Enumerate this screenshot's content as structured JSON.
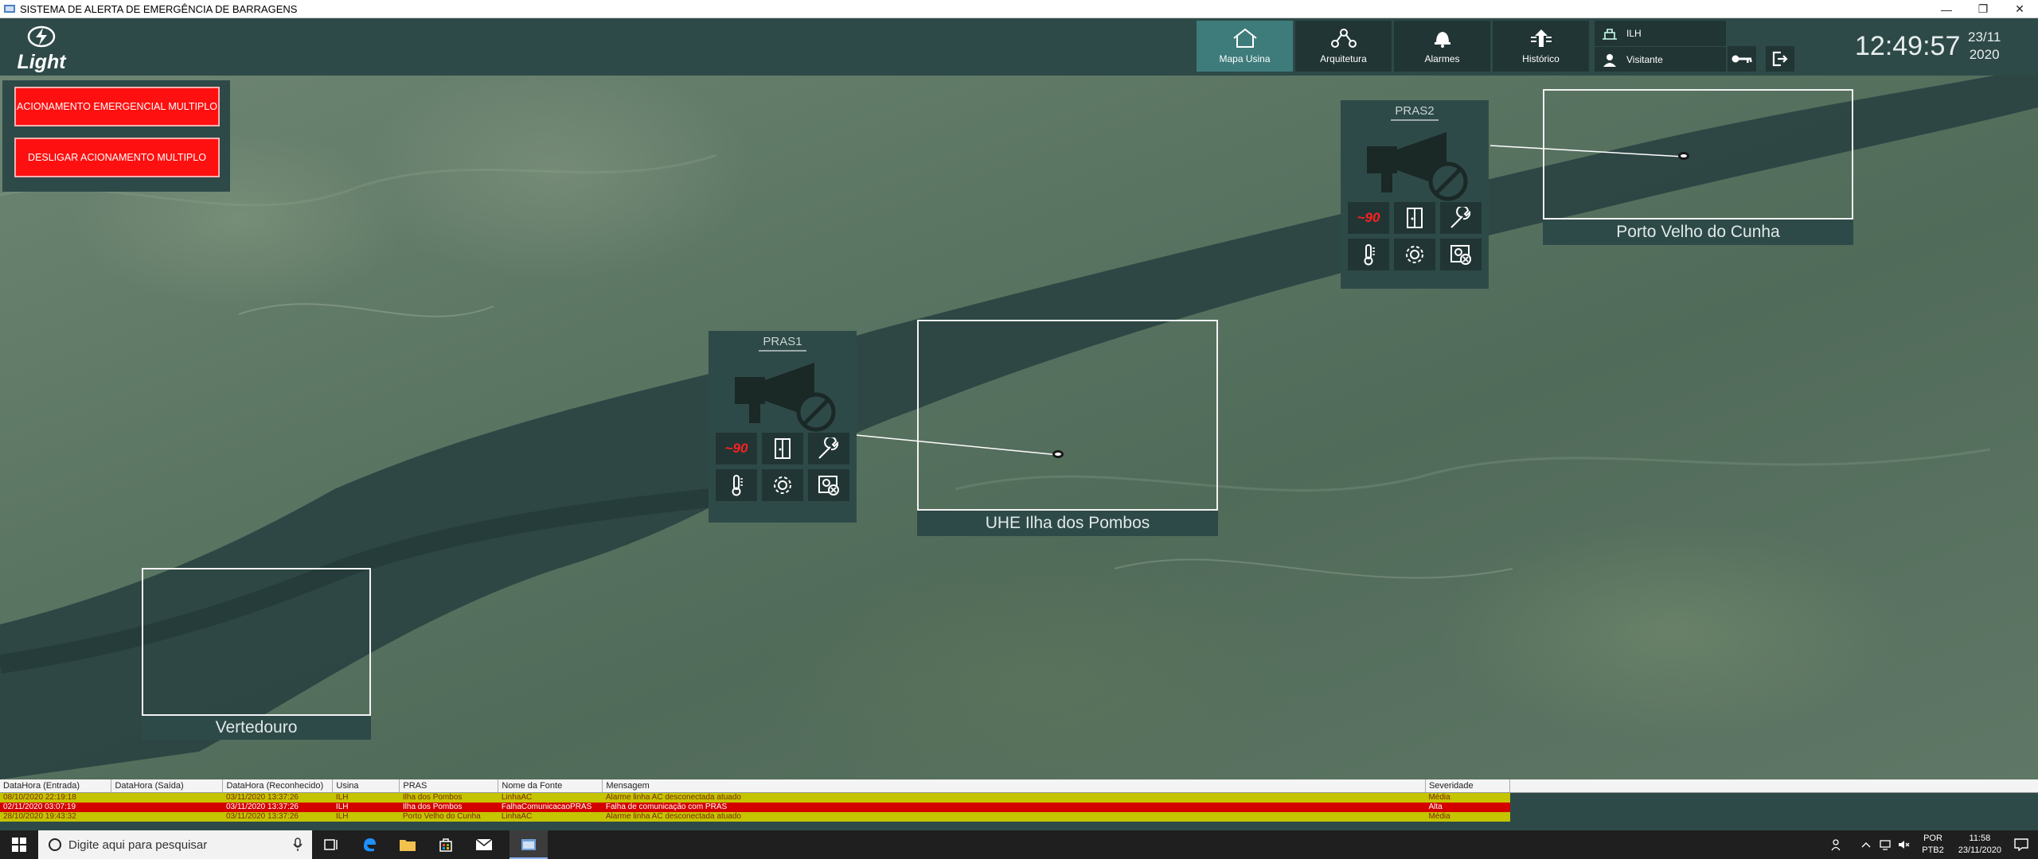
{
  "window": {
    "title": "SISTEMA DE ALERTA DE EMERGÊNCIA DE BARRAGENS",
    "minimize": "—",
    "restore": "❐",
    "close": "✕"
  },
  "header": {
    "logo_text": "Light",
    "nav": [
      {
        "label": "Mapa Usina",
        "icon": "home-icon",
        "active": true
      },
      {
        "label": "Arquitetura",
        "icon": "network-icon",
        "active": false
      },
      {
        "label": "Alarmes",
        "icon": "bell-icon",
        "active": false
      },
      {
        "label": "Histórico",
        "icon": "history-icon",
        "active": false
      }
    ],
    "user": {
      "plant": "ILH",
      "name": "Visitante"
    },
    "clock": "12:49:57",
    "date_day": "23/11",
    "date_year": "2020"
  },
  "controls": {
    "emergency_multi": "ACIONAMENTO EMERGENCIAL MULTIPLO",
    "disable_multi": "DESLIGAR ACIONAMENTO MULTIPLO"
  },
  "map": {
    "pras": [
      {
        "title": "PRAS1",
        "fault_text": "~90"
      },
      {
        "title": "PRAS2",
        "fault_text": "~90"
      }
    ],
    "sites": [
      {
        "label": "UHE Ilha dos Pombos"
      },
      {
        "label": "Porto Velho do Cunha"
      },
      {
        "label": "Vertedouro"
      }
    ]
  },
  "alarms": {
    "columns": [
      "DataHora (Entrada)",
      "DataHora (Saída)",
      "DataHora (Reconhecido)",
      "Usina",
      "PRAS",
      "Nome da Fonte",
      "Mensagem",
      "Severidade"
    ],
    "rows": [
      {
        "entrada": "08/10/2020 22:19:18",
        "saida": "",
        "reconhecido": "03/11/2020 13:37:26",
        "usina": "ILH",
        "pras": "Ilha dos Pombos",
        "fonte": "LinhaAC",
        "mensagem": "Alarme linha AC desconectada atuado",
        "severidade": "Média"
      },
      {
        "entrada": "02/11/2020 03:07:19",
        "saida": "",
        "reconhecido": "03/11/2020 13:37:26",
        "usina": "ILH",
        "pras": "Ilha dos Pombos",
        "fonte": "FalhaComunicacaoPRAS",
        "mensagem": "Falha de comunicação com PRAS",
        "severidade": "Alta"
      },
      {
        "entrada": "28/10/2020 19:43:32",
        "saida": "",
        "reconhecido": "03/11/2020 13:37:26",
        "usina": "ILH",
        "pras": "Porto Velho do Cunha",
        "fonte": "LinhaAC",
        "mensagem": "Alarme linha AC desconectada atuado",
        "severidade": "Média"
      }
    ]
  },
  "taskbar": {
    "search_placeholder": "Digite aqui para pesquisar",
    "lang_top": "POR",
    "lang_bottom": "PTB2",
    "time": "11:58",
    "date": "23/11/2020"
  },
  "colors": {
    "panel": "#2e4a48",
    "panel_dark": "#213534",
    "active_nav": "#3e7c7b",
    "emergency_red": "#ff1010",
    "severity_media": "#c4c400",
    "severity_alta": "#d40000"
  }
}
